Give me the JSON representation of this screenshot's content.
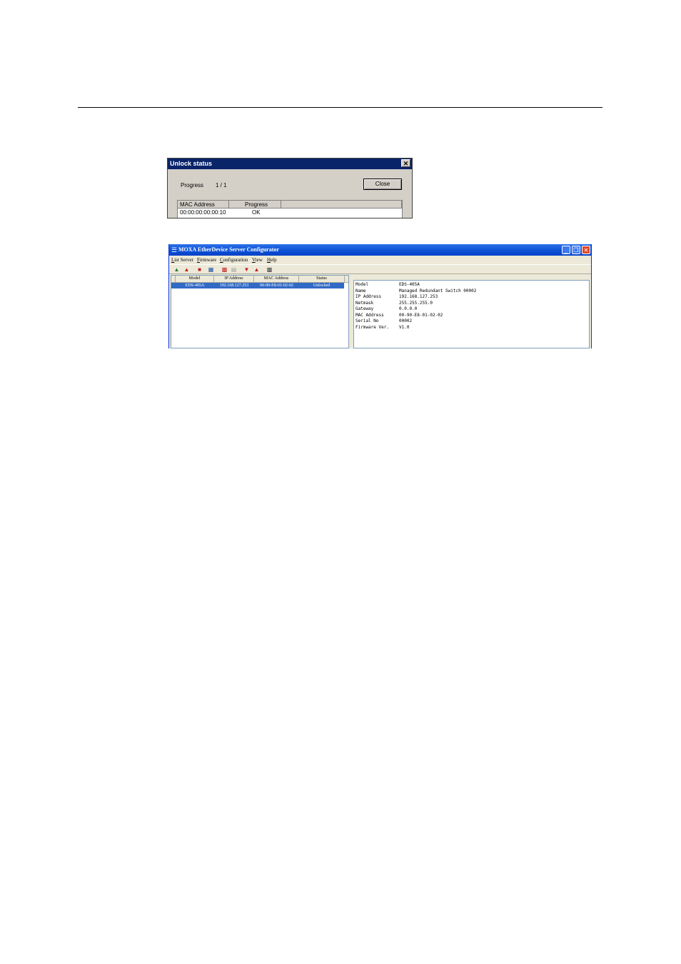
{
  "unlock_dialog": {
    "title": "Unlock status",
    "close_x": "✕",
    "progress_label": "Progress",
    "progress_value": "1 / 1",
    "close_button": "Close",
    "columns": [
      "MAC Address",
      "Progress"
    ],
    "rows": [
      {
        "mac": "00:00:00:00:00:10",
        "progress": "OK"
      }
    ]
  },
  "configurator": {
    "title": "MOXA EtherDevice Server Configurator",
    "menu": [
      "List Server",
      "Firmware",
      "Configuration",
      "View",
      "Help"
    ],
    "toolbar_icons": [
      "search-icon",
      "stop-icon",
      "server-icon",
      "settings-icon",
      "network-icon",
      "disabled-icon",
      "download-icon",
      "upload-icon",
      "export-icon"
    ],
    "list_columns": [
      "Model",
      "IP Address",
      "MAC Address",
      "Status"
    ],
    "list_rows": [
      {
        "model": "EDS-405A",
        "ip": "192.168.127.253",
        "mac": "00-90-E8-01-02-02",
        "status": "Unlocked"
      }
    ],
    "details": [
      {
        "key": "Model",
        "value": "EDS-405A"
      },
      {
        "key": "Name",
        "value": "Managed Redundant Switch 00002"
      },
      {
        "key": "IP Address",
        "value": "192.168.127.253"
      },
      {
        "key": "Netmask",
        "value": "255.255.255.0"
      },
      {
        "key": "Gateway",
        "value": "0.0.0.0"
      },
      {
        "key": "MAC Address",
        "value": "00-90-E8-01-02-02"
      },
      {
        "key": "Serial No",
        "value": "00002"
      },
      {
        "key": "Firmware Ver.",
        "value": "V1.0"
      }
    ],
    "colors": {
      "titlebar": "#0a4fd4",
      "selection": "#316ac5"
    }
  }
}
